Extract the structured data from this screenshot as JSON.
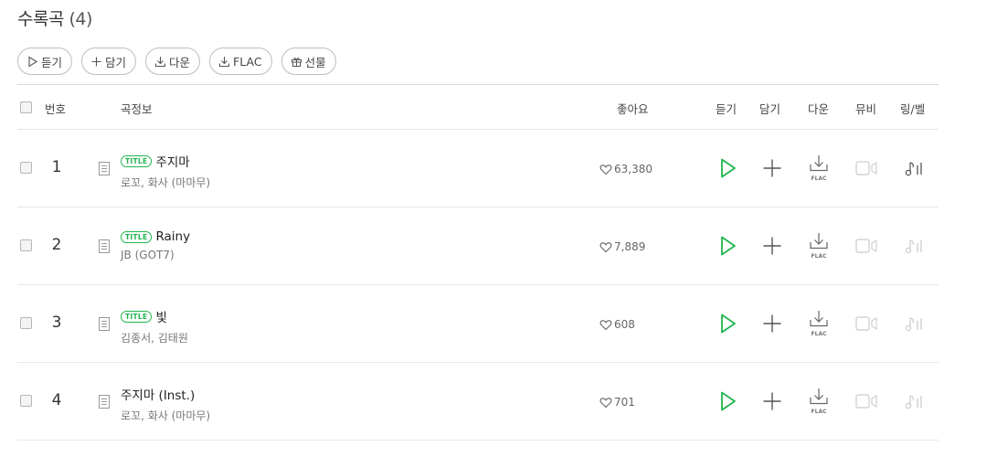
{
  "header": {
    "title": "수록곡",
    "count": "(4)"
  },
  "toolbar": {
    "listen": "듣기",
    "add": "담기",
    "download": "다운",
    "flac": "FLAC",
    "gift": "선물"
  },
  "columns": {
    "number": "번호",
    "song_info": "곡정보",
    "likes": "좋아요",
    "listen": "듣기",
    "add": "담기",
    "download": "다운",
    "mv": "뮤비",
    "ring": "링/벨"
  },
  "flac_label": "FLAC",
  "tracks": [
    {
      "rank": "1",
      "title_badge": "TITLE",
      "title": "주지마",
      "artist": "로꼬, 화사 (마마무)",
      "likes": "63,380",
      "ring_active": true
    },
    {
      "rank": "2",
      "title_badge": "TITLE",
      "title": "Rainy",
      "artist": "JB (GOT7)",
      "likes": "7,889",
      "ring_active": false
    },
    {
      "rank": "3",
      "title_badge": "TITLE",
      "title": "빛",
      "artist": "김종서, 김태원",
      "likes": "608",
      "ring_active": false
    },
    {
      "rank": "4",
      "title_badge": "",
      "title": "주지마 (Inst.)",
      "artist": "로꼬, 화사 (마마무)",
      "likes": "701",
      "ring_active": false
    }
  ],
  "colors": {
    "accent": "#21b54d",
    "text": "#333333",
    "muted": "#777777",
    "border": "#d9d9d9"
  }
}
